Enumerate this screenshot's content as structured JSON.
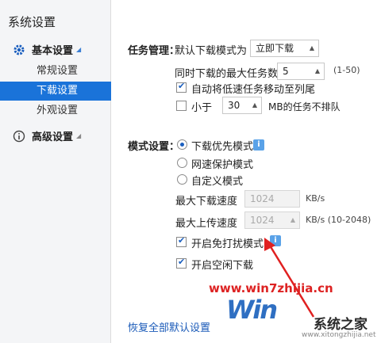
{
  "sidebar": {
    "title": "系统设置",
    "basic_group": "基本设置",
    "items": [
      {
        "label": "常规设置",
        "active": false
      },
      {
        "label": "下载设置",
        "active": true
      },
      {
        "label": "外观设置",
        "active": false
      }
    ],
    "advanced_group": "高级设置"
  },
  "task": {
    "section_label": "任务管理：",
    "default_mode_label": "默认下载模式为",
    "default_mode_value": "立即下载",
    "max_tasks_label": "同时下载的最大任务数",
    "max_tasks_value": "5",
    "max_tasks_range": "(1-50)",
    "auto_move_label": "自动将低速任务移动至列尾",
    "less_than_label": "小于",
    "less_than_value": "30",
    "less_than_suffix": "MB的任务不排队"
  },
  "mode": {
    "section_label": "模式设置：",
    "options": [
      "下载优先模式",
      "网速保护模式",
      "自定义模式"
    ],
    "max_down_label": "最大下载速度",
    "max_down_value": "1024",
    "max_down_unit": "KB/s",
    "max_up_label": "最大上传速度",
    "max_up_value": "1024",
    "max_up_unit": "KB/s  (10-2048)",
    "no_disturb_label": "开启免打扰模式",
    "idle_download_label": "开启空闲下载"
  },
  "footer": {
    "restore_link": "恢复全部默认设置"
  },
  "watermark": {
    "url": "www.win7zhijia.cn",
    "logo": "Win",
    "brand": "系统之家",
    "site": "www.xitongzhijia.net"
  },
  "colors": {
    "accent": "#1a73d9",
    "link": "#1a5ab8",
    "watermark_red": "#dd2222"
  }
}
